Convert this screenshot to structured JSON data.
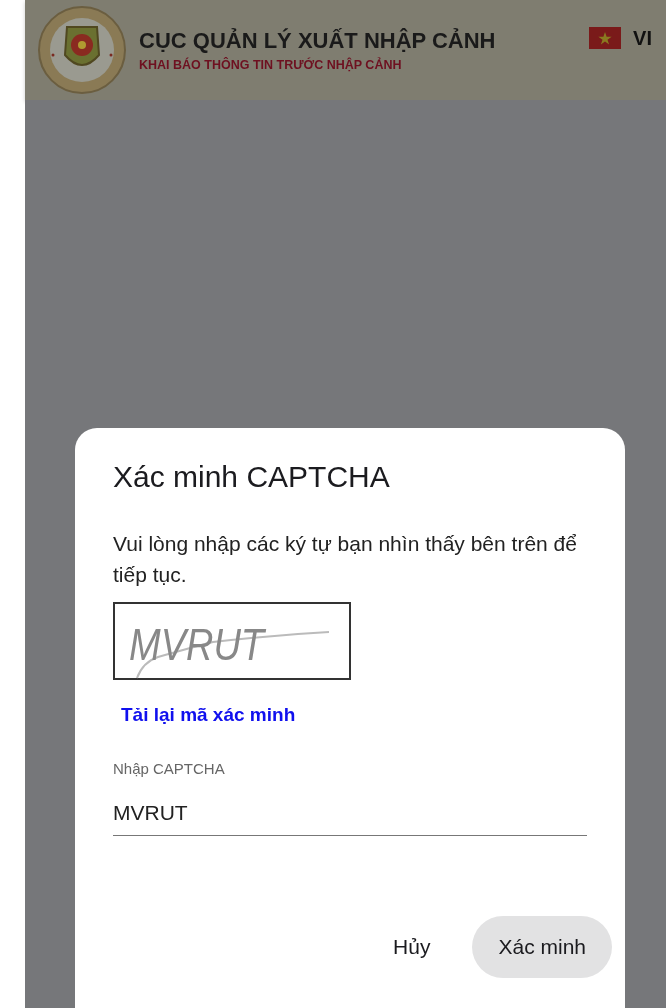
{
  "header": {
    "title": "CỤC QUẢN LÝ XUẤT NHẬP CẢNH",
    "subtitle": "KHAI BÁO THÔNG TIN TRƯỚC NHẬP CẢNH",
    "language": "VI"
  },
  "dialog": {
    "title": "Xác minh CAPTCHA",
    "message": "Vui lòng nhập các ký tự bạn nhìn thấy bên trên để tiếp tục.",
    "captcha_image_text": "MVRUT",
    "reload_link": "Tải lại mã xác minh",
    "field": {
      "label": "Nhập CAPTCHA",
      "value": "MVRUT"
    },
    "buttons": [
      {
        "label": "Hủy",
        "kind": "text"
      },
      {
        "label": "Xác minh",
        "kind": "filled"
      }
    ]
  }
}
